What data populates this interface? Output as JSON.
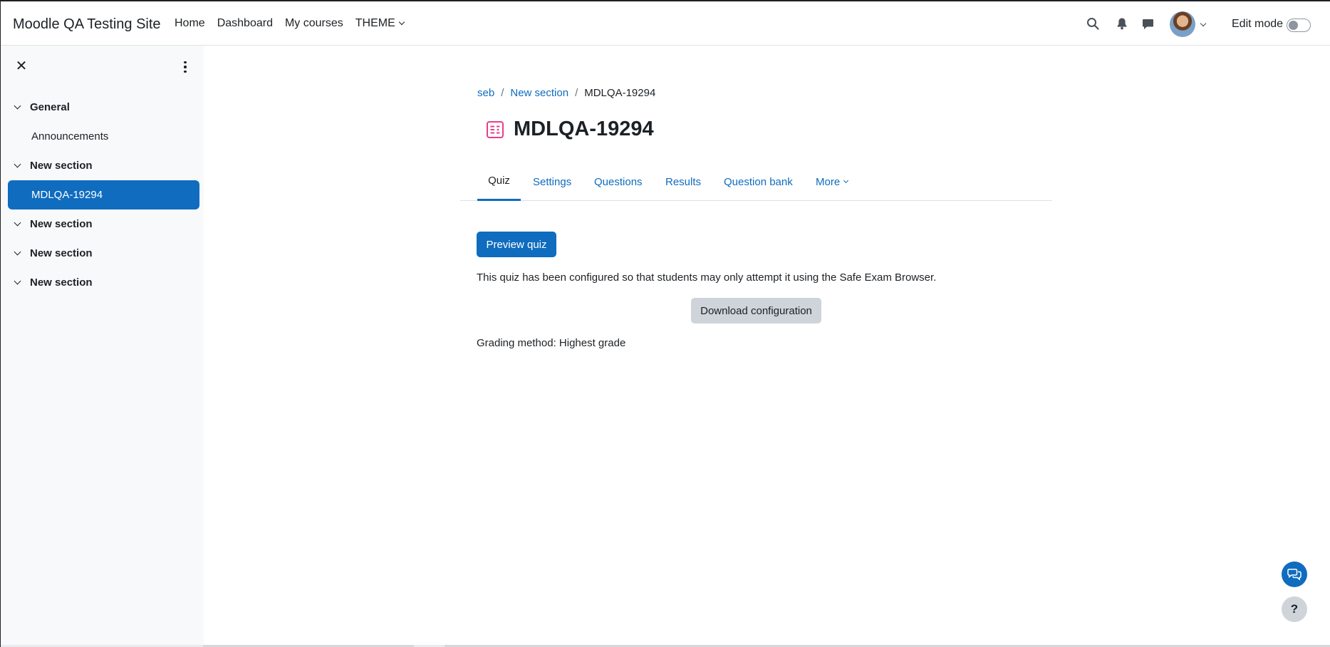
{
  "navbar": {
    "brand": "Moodle QA Testing Site",
    "links": [
      {
        "label": "Home"
      },
      {
        "label": "Dashboard"
      },
      {
        "label": "My courses"
      },
      {
        "label": "THEME"
      }
    ],
    "edit_mode_label": "Edit mode",
    "edit_mode_on": false,
    "icons": [
      "search-icon",
      "bell-icon",
      "chat-icon",
      "user-avatar",
      "chevron-down-icon"
    ]
  },
  "course_index": {
    "sections": [
      {
        "title": "General",
        "items": [
          "Announcements"
        ]
      },
      {
        "title": "New section",
        "items": [
          "MDLQA-19294"
        ]
      },
      {
        "title": "New section",
        "items": []
      },
      {
        "title": "New section",
        "items": []
      },
      {
        "title": "New section",
        "items": []
      }
    ],
    "active_item": "MDLQA-19294"
  },
  "breadcrumb": {
    "items": [
      "seb",
      "New section",
      "MDLQA-19294"
    ],
    "separator": "/"
  },
  "page": {
    "title": "MDLQA-19294",
    "icon": "quiz-icon",
    "icon_color": "#e83e8c"
  },
  "tabs": {
    "items": [
      "Quiz",
      "Settings",
      "Questions",
      "Results",
      "Question bank",
      "More"
    ],
    "active": "Quiz"
  },
  "content": {
    "preview_button": "Preview quiz",
    "seb_notice": "This quiz has been configured so that students may only attempt it using the Safe Exam Browser.",
    "download_button": "Download configuration",
    "grading_method": "Grading method: Highest grade"
  },
  "floating": {
    "help_label": "?"
  },
  "colors": {
    "primary": "#0f6cbf",
    "drawer_bg": "#f8f9fa",
    "secondary_button": "#ced4da"
  }
}
